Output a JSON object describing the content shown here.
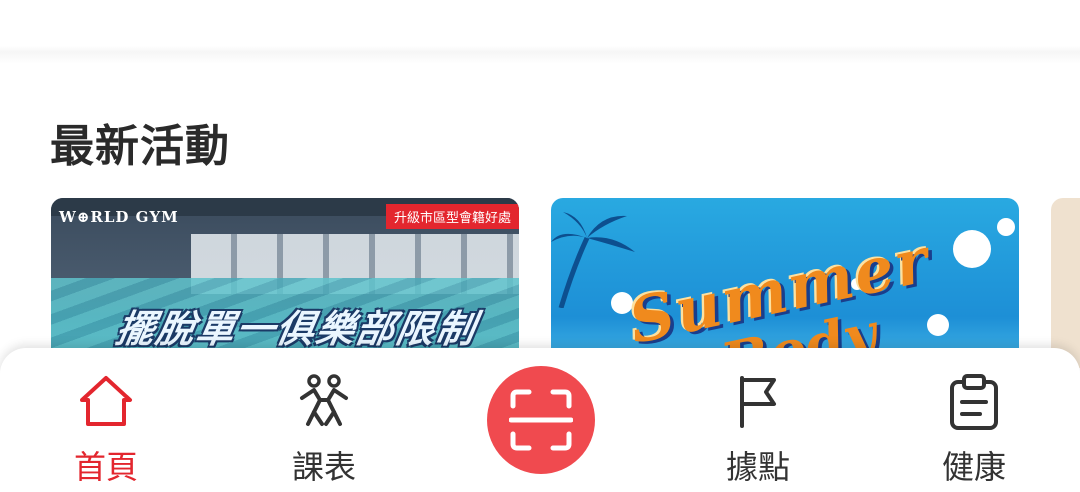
{
  "colors": {
    "accent": "#e3262e",
    "scan_button": "#f04a4f",
    "text_dark": "#2a2a2a",
    "text_nav": "#333333"
  },
  "section": {
    "title": "最新活動"
  },
  "carousel": {
    "cards": [
      {
        "logo": "W⊕RLD GYM",
        "tag": "升級市區型會籍好處",
        "slogan": "擺脫單一俱樂部限制"
      },
      {
        "headline_1": "Summer",
        "headline_2": "Body"
      },
      {}
    ]
  },
  "bottom_nav": {
    "items": [
      {
        "label": "首頁",
        "icon": "home-icon",
        "active": true
      },
      {
        "label": "課表",
        "icon": "dancers-icon",
        "active": false
      },
      {
        "label": "",
        "icon": "scan-icon",
        "active": false
      },
      {
        "label": "據點",
        "icon": "flag-icon",
        "active": false
      },
      {
        "label": "健康",
        "icon": "clipboard-icon",
        "active": false
      }
    ]
  }
}
